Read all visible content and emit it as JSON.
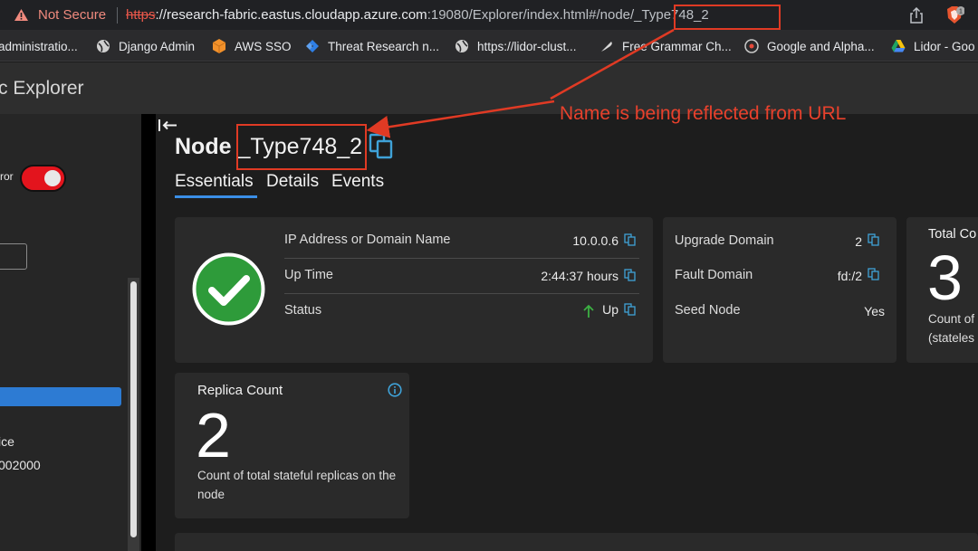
{
  "browser": {
    "security_label": "Not Secure",
    "url_scheme": "https",
    "url_host": "://research-fabric.eastus.cloudapp.azure.com",
    "url_path": ":19080/Explorer/index.html#/node/",
    "url_node": "_Type748_2",
    "brave_badge": "1"
  },
  "bookmarks": [
    {
      "label": "administratio...",
      "icon": "web-icon"
    },
    {
      "label": "Django Admin",
      "icon": "globe-icon"
    },
    {
      "label": "AWS SSO",
      "icon": "aws-cube-icon"
    },
    {
      "label": "Threat Research n...",
      "icon": "jira-icon"
    },
    {
      "label": "https://lidor-clust...",
      "icon": "globe-icon"
    },
    {
      "label": "Free Grammar Ch...",
      "icon": "feather-icon"
    },
    {
      "label": "Google and Alpha...",
      "icon": "record-icon"
    },
    {
      "label": "Lidor - Goo",
      "icon": "google-drive-icon"
    }
  ],
  "app": {
    "title": "c Explorer"
  },
  "sidebar": {
    "toggle_label": "ror",
    "toggle_on": true,
    "text1": "ice",
    "text2": "002000"
  },
  "node": {
    "label": "Node",
    "name": "_Type748_2",
    "tabs": [
      "Essentials",
      "Details",
      "Events"
    ],
    "active_tab": "Essentials"
  },
  "essentials": {
    "rows": [
      {
        "label": "IP Address or Domain Name",
        "value": "10.0.0.6"
      },
      {
        "label": "Up Time",
        "value": "2:44:37 hours"
      },
      {
        "label": "Status",
        "value": "Up"
      }
    ]
  },
  "domain_card": {
    "rows": [
      {
        "label": "Upgrade Domain",
        "value": "2"
      },
      {
        "label": "Fault Domain",
        "value": "fd:/2"
      },
      {
        "label": "Seed Node",
        "value": "Yes"
      }
    ]
  },
  "total_card": {
    "title": "Total Co",
    "count": "3",
    "desc1": "Count of",
    "desc2": "(stateles"
  },
  "replica_card": {
    "title": "Replica Count",
    "count": "2",
    "desc": "Count of total stateful replicas on the node"
  },
  "annotation": {
    "text": "Name is being reflected from URL",
    "color": "#e8412c"
  },
  "colors": {
    "accent": "#3a8ee6",
    "success": "#2e9b3a",
    "danger": "#e3141d"
  }
}
